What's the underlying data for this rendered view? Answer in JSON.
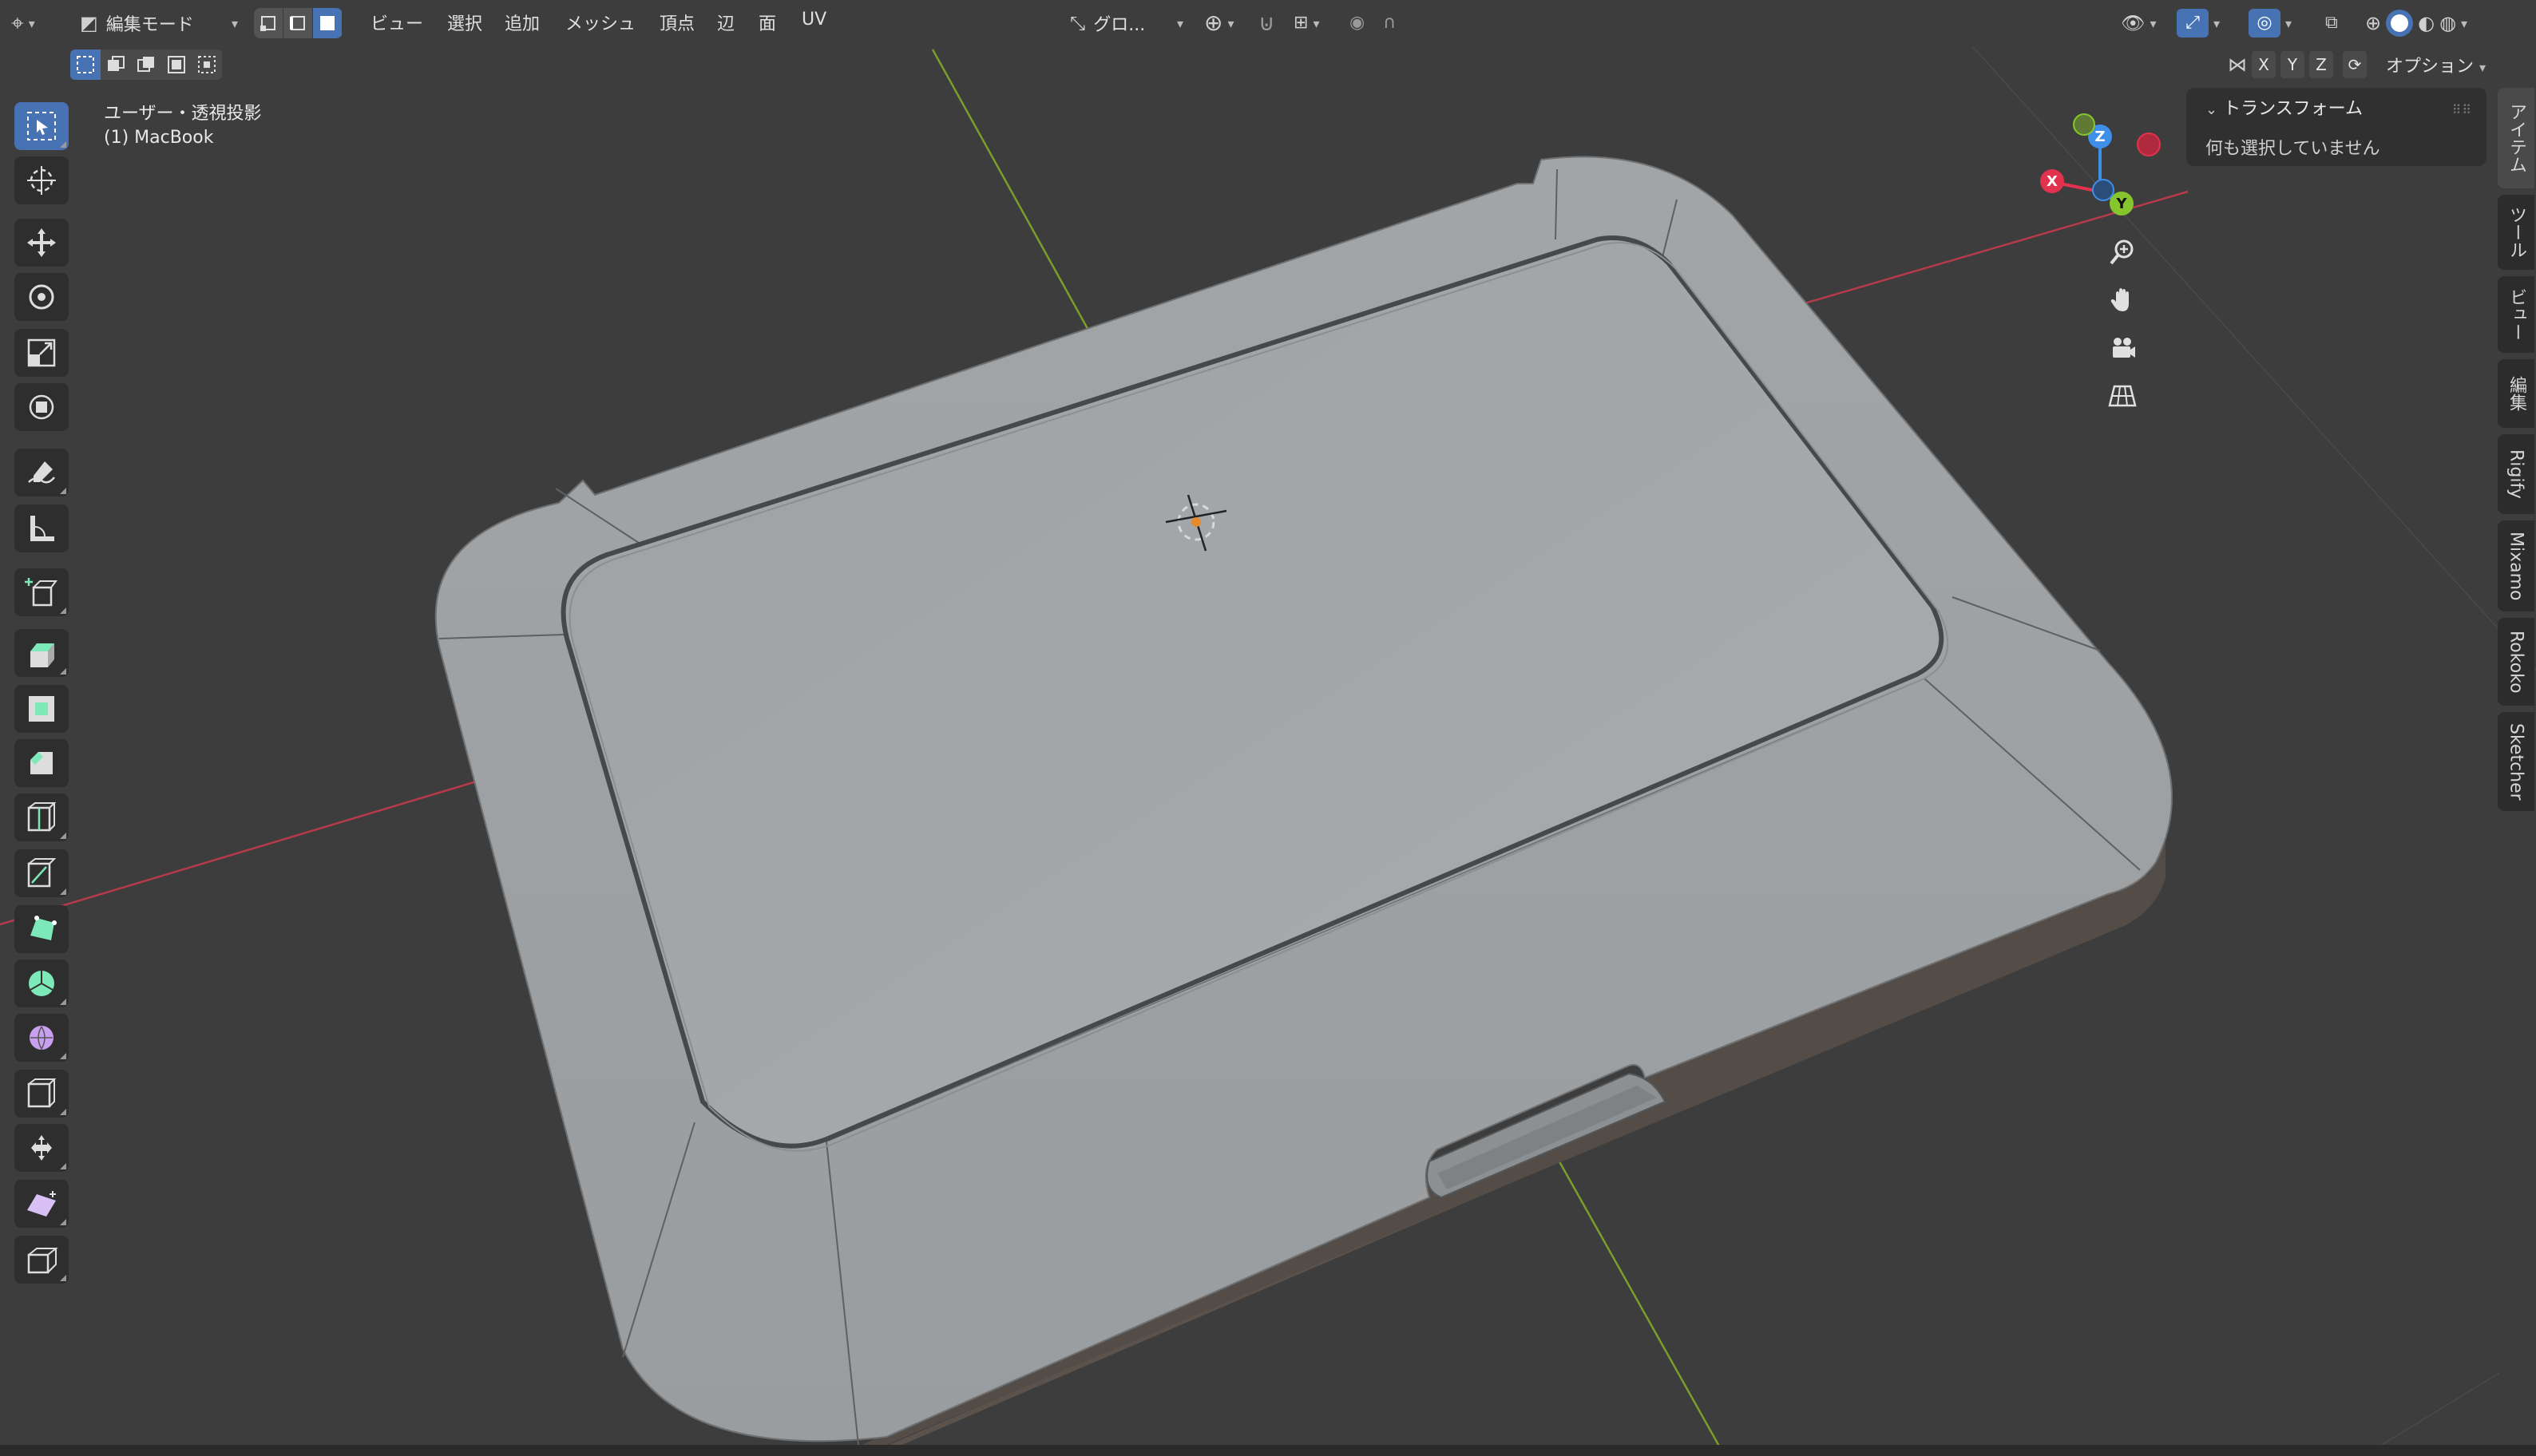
{
  "header": {
    "editor_type_icon": "editor-type-icon",
    "mode_label": "編集モード",
    "mode_icon": "edit-mode-icon",
    "menus": [
      "ビュー",
      "選択",
      "追加",
      "メッシュ",
      "頂点",
      "辺",
      "面",
      "UV"
    ],
    "transform_orientation": "グロ...",
    "options_label": "オプション",
    "mirror_axes": [
      "X",
      "Y",
      "Z"
    ]
  },
  "viewport": {
    "view_name": "ユーザー・透視投影",
    "object_label": "(1) MacBook"
  },
  "gizmo": {
    "x_label": "X",
    "y_label": "Y",
    "z_label": "Z",
    "colors": {
      "x": "#e3324d",
      "y": "#86c52e",
      "z": "#3f8ee8"
    }
  },
  "npanel": {
    "section_title": "トランスフォーム",
    "empty_message": "何も選択していません"
  },
  "sidebar_tabs": [
    "アイテム",
    "ツール",
    "ビュー",
    "編集",
    "Rigify",
    "Mixamo",
    "Rokoko",
    "Sketcher"
  ],
  "colors": {
    "accent": "#4772b3",
    "background": "#3d3d3d",
    "mesh_face": "#a3a6a8"
  }
}
